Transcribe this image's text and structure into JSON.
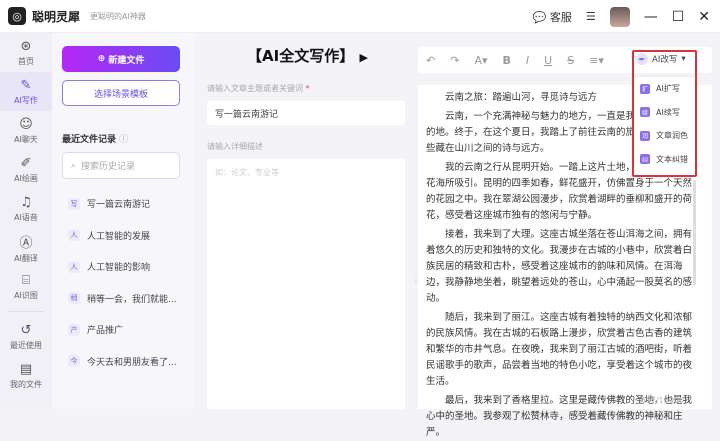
{
  "app": {
    "name": "聪明灵犀",
    "slogan": "更聪明的AI神器",
    "service": "客服"
  },
  "nav": [
    {
      "icon": "⊛",
      "label": "首页"
    },
    {
      "icon": "✎",
      "label": "AI写作"
    },
    {
      "icon": "☺",
      "label": "AI聊天"
    },
    {
      "icon": "✐",
      "label": "AI绘画"
    },
    {
      "icon": "♫",
      "label": "AI语音"
    },
    {
      "icon": "Ⓐ",
      "label": "AI翻译"
    },
    {
      "icon": "⌸",
      "label": "AI识图"
    },
    {
      "icon": "↺",
      "label": "最近使用"
    },
    {
      "icon": "▤",
      "label": "我的文件"
    }
  ],
  "sidebar": {
    "new_file": "新建文件",
    "template": "选择场景模板",
    "recent_title": "最近文件记录",
    "search_placeholder": "搜索历史记录",
    "items": [
      {
        "badge": "写",
        "label": "写一篇云南游记"
      },
      {
        "badge": "人",
        "label": "人工智能的发展"
      },
      {
        "badge": "人",
        "label": "人工智能的影响"
      },
      {
        "badge": "稍",
        "label": "稍等一会，我们就能..."
      },
      {
        "badge": "产",
        "label": "产品推广"
      },
      {
        "badge": "今",
        "label": "今天去和男朋友看了..."
      }
    ]
  },
  "form": {
    "title": "【AI全文写作】",
    "topic_label": "请输入文章主题或者关键词",
    "required": "*",
    "topic_value": "写一篇云南游记",
    "desc_label": "请输入详细描述",
    "desc_placeholder": "如：论文、专业等"
  },
  "editor": {
    "heading": "云南之旅：踏遍山河，寻觅诗与远方",
    "paragraphs": [
      "云南，一个充满神秘与魅力的地方，一直是我心中向往的目的地。终于，在这个夏日，我踏上了前往云南的旅程，去探寻那些藏在山川之间的诗与远方。",
      "我的云南之行从昆明开始。一踏上这片土地，我就被这里的花海所吸引。昆明的四季如春，鲜花盛开，仿佛置身于一个天然的花园之中。我在翠湖公园漫步，欣赏着湖畔的垂柳和盛开的荷花，感受着这座城市独有的悠闲与宁静。",
      "接着，我来到了大理。这座古城坐落在苍山洱海之间，拥有着悠久的历史和独特的文化。我漫步在古城的小巷中，欣赏着白族民居的精致和古朴，感受着这座城市的韵味和风情。在洱海边，我静静地坐着，眺望着远处的苍山，心中涌起一股莫名的感动。",
      "随后，我来到了丽江。这座古城有着独特的纳西文化和浓郁的民族风情。我在古城的石板路上漫步，欣赏着古色古香的建筑和繁华的市井气息。在夜晚，我来到了丽江古城的酒吧街，听着民谣歌手的歌声，品尝着当地的特色小吃，享受着这个城市的夜生活。",
      "最后，我来到了香格里拉。这里是藏传佛教的圣地，也是我心中的圣地。我参观了松赞林寺，感受着藏传佛教的神秘和庄严。"
    ],
    "counter": "677/10000"
  },
  "toolbar": {
    "ai_rewrite": "AI改写",
    "menu": [
      {
        "icon": "扩",
        "label": "AI扩写"
      },
      {
        "icon": "续",
        "label": "AI续写"
      },
      {
        "icon": "润",
        "label": "文章润色"
      },
      {
        "icon": "纠",
        "label": "文本纠错"
      }
    ]
  }
}
